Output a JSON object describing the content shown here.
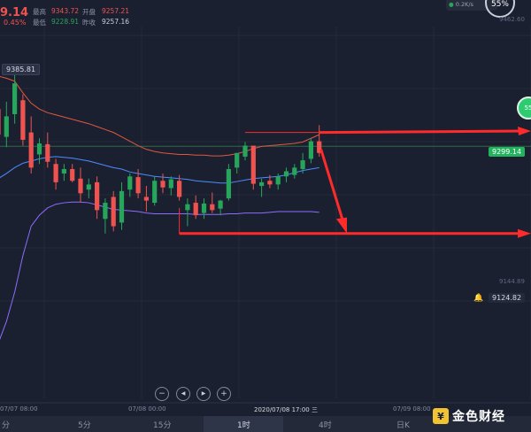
{
  "header": {
    "last_price": "9.14",
    "change_pct": "0.45%",
    "high_label": "最高",
    "high_value": "9343.72",
    "open_label": "开盘",
    "open_value": "9257.21",
    "low_label": "最低",
    "low_value": "9228.91",
    "prev_close_label": "昨收",
    "prev_close_value": "9257.16"
  },
  "top_right": {
    "net_speed": "0.2K/s",
    "percent": "55%"
  },
  "price_tags": {
    "left_high": "9385.81",
    "current": "9299.14",
    "alert": "9124.82",
    "side_badge": "55"
  },
  "right_scale": [
    "9462.60",
    "9144.89"
  ],
  "time_axis": [
    "07/07 08:00",
    "07/08 00:00",
    "2020/07/08 17:00 三",
    "07/09 08:00"
  ],
  "nav_buttons": {
    "zoom_out": "−",
    "prev": "◀",
    "next": "▶",
    "zoom_in": "+"
  },
  "timeframes": [
    {
      "label": "分",
      "active": false
    },
    {
      "label": "5分",
      "active": false
    },
    {
      "label": "15分",
      "active": false
    },
    {
      "label": "1时",
      "active": true
    },
    {
      "label": "4时",
      "active": false
    },
    {
      "label": "日K",
      "active": false
    }
  ],
  "logo": {
    "text": "金色财经"
  },
  "colors": {
    "up": "#26a65b",
    "down": "#ef5350",
    "ma": "#4b8cff",
    "upper_band": "#e0573f",
    "lower_band": "#8d6cff",
    "arrow": "#ff2a2a"
  },
  "chart_data": {
    "type": "candlestick",
    "candles": [
      {
        "o": 9350,
        "h": 9372,
        "l": 9305,
        "c": 9315
      },
      {
        "o": 9312,
        "h": 9360,
        "l": 9298,
        "c": 9340
      },
      {
        "o": 9343,
        "h": 9400,
        "l": 9330,
        "c": 9385
      },
      {
        "o": 9362,
        "h": 9370,
        "l": 9300,
        "c": 9308
      },
      {
        "o": 9318,
        "h": 9340,
        "l": 9262,
        "c": 9270
      },
      {
        "o": 9288,
        "h": 9310,
        "l": 9275,
        "c": 9303
      },
      {
        "o": 9302,
        "h": 9318,
        "l": 9270,
        "c": 9278
      },
      {
        "o": 9275,
        "h": 9282,
        "l": 9240,
        "c": 9250
      },
      {
        "o": 9262,
        "h": 9275,
        "l": 9252,
        "c": 9268
      },
      {
        "o": 9268,
        "h": 9275,
        "l": 9250,
        "c": 9252
      },
      {
        "o": 9255,
        "h": 9270,
        "l": 9222,
        "c": 9235
      },
      {
        "o": 9240,
        "h": 9255,
        "l": 9228,
        "c": 9247
      },
      {
        "o": 9250,
        "h": 9258,
        "l": 9200,
        "c": 9212
      },
      {
        "o": 9200,
        "h": 9228,
        "l": 9180,
        "c": 9222
      },
      {
        "o": 9230,
        "h": 9238,
        "l": 9183,
        "c": 9190
      },
      {
        "o": 9195,
        "h": 9250,
        "l": 9185,
        "c": 9238
      },
      {
        "o": 9240,
        "h": 9262,
        "l": 9230,
        "c": 9258
      },
      {
        "o": 9257,
        "h": 9268,
        "l": 9228,
        "c": 9235
      },
      {
        "o": 9230,
        "h": 9245,
        "l": 9210,
        "c": 9225
      },
      {
        "o": 9222,
        "h": 9258,
        "l": 9218,
        "c": 9252
      },
      {
        "o": 9252,
        "h": 9262,
        "l": 9235,
        "c": 9243
      },
      {
        "o": 9242,
        "h": 9258,
        "l": 9232,
        "c": 9254
      },
      {
        "o": 9252,
        "h": 9260,
        "l": 9225,
        "c": 9230
      },
      {
        "o": 9212,
        "h": 9228,
        "l": 9190,
        "c": 9220
      },
      {
        "o": 9222,
        "h": 9232,
        "l": 9200,
        "c": 9205
      },
      {
        "o": 9208,
        "h": 9228,
        "l": 9200,
        "c": 9221
      },
      {
        "o": 9220,
        "h": 9236,
        "l": 9208,
        "c": 9212
      },
      {
        "o": 9214,
        "h": 9226,
        "l": 9205,
        "c": 9225
      },
      {
        "o": 9228,
        "h": 9275,
        "l": 9225,
        "c": 9268
      },
      {
        "o": 9270,
        "h": 9290,
        "l": 9262,
        "c": 9290
      },
      {
        "o": 9285,
        "h": 9305,
        "l": 9280,
        "c": 9300
      },
      {
        "o": 9300,
        "h": 9300,
        "l": 9240,
        "c": 9248
      },
      {
        "o": 9245,
        "h": 9255,
        "l": 9230,
        "c": 9250
      },
      {
        "o": 9252,
        "h": 9260,
        "l": 9242,
        "c": 9247
      },
      {
        "o": 9247,
        "h": 9262,
        "l": 9240,
        "c": 9258
      },
      {
        "o": 9258,
        "h": 9270,
        "l": 9250,
        "c": 9265
      },
      {
        "o": 9260,
        "h": 9275,
        "l": 9255,
        "c": 9270
      },
      {
        "o": 9268,
        "h": 9290,
        "l": 9262,
        "c": 9280
      },
      {
        "o": 9282,
        "h": 9310,
        "l": 9276,
        "c": 9306
      },
      {
        "o": 9306,
        "h": 9328,
        "l": 9285,
        "c": 9290
      }
    ],
    "ma": [
      9255,
      9262,
      9270,
      9276,
      9279,
      9282,
      9284,
      9285,
      9284,
      9283,
      9281,
      9279,
      9276,
      9273,
      9270,
      9268,
      9264,
      9262,
      9260,
      9258,
      9257,
      9256,
      9255,
      9254,
      9252,
      9251,
      9250,
      9249,
      9249,
      9251,
      9253,
      9255,
      9256,
      9257,
      9258,
      9260,
      9263,
      9266,
      9268,
      9270
    ],
    "upper_band": [
      9395,
      9392,
      9388,
      9372,
      9358,
      9350,
      9345,
      9342,
      9339,
      9336,
      9333,
      9330,
      9326,
      9322,
      9318,
      9312,
      9306,
      9300,
      9295,
      9292,
      9290,
      9289,
      9288,
      9288,
      9287,
      9287,
      9286,
      9286,
      9287,
      9289,
      9292,
      9296,
      9299,
      9300,
      9301,
      9302,
      9303,
      9305,
      9310,
      9315
    ],
    "lower_band": [
      9030,
      9060,
      9100,
      9150,
      9190,
      9205,
      9215,
      9220,
      9222,
      9223,
      9223,
      9222,
      9219,
      9216,
      9213,
      9212,
      9211,
      9210,
      9208,
      9207,
      9207,
      9207,
      9207,
      9207,
      9206,
      9206,
      9206,
      9206,
      9207,
      9207,
      9208,
      9208,
      9208,
      9209,
      9210,
      9210,
      9210,
      9210,
      9210,
      9209
    ],
    "ylim": [
      9100,
      9462.6
    ]
  }
}
